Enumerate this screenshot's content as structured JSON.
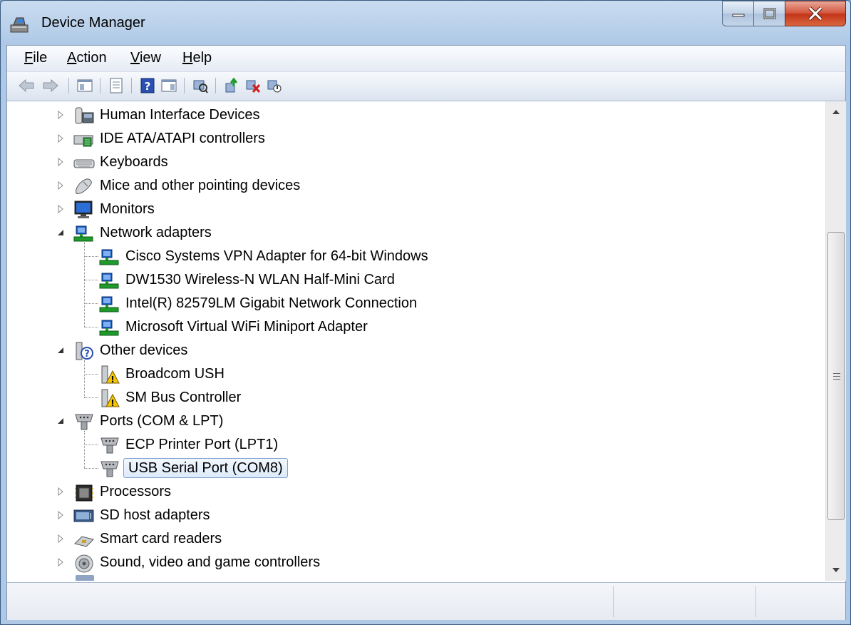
{
  "window": {
    "title": "Device Manager",
    "icon": "device-manager-icon"
  },
  "menu": {
    "items": [
      "File",
      "Action",
      "View",
      "Help"
    ],
    "mnemonics": [
      "F",
      "A",
      "V",
      "H"
    ]
  },
  "toolbar": {
    "buttons": [
      "back-arrow-icon",
      "forward-arrow-icon",
      "show-hide-console-tree-icon",
      "properties-icon",
      "help-icon",
      "show-action-pane-icon",
      "scan-hardware-changes-icon",
      "update-driver-icon",
      "uninstall-icon",
      "disable-device-icon"
    ]
  },
  "tree": {
    "rows": [
      {
        "label": "Human Interface Devices",
        "level": 0,
        "state": "collapsed",
        "icon": "hid-icon"
      },
      {
        "label": "IDE ATA/ATAPI controllers",
        "level": 0,
        "state": "collapsed",
        "icon": "ide-controller-icon"
      },
      {
        "label": "Keyboards",
        "level": 0,
        "state": "collapsed",
        "icon": "keyboard-icon"
      },
      {
        "label": "Mice and other pointing devices",
        "level": 0,
        "state": "collapsed",
        "icon": "mouse-icon"
      },
      {
        "label": "Monitors",
        "level": 0,
        "state": "collapsed",
        "icon": "monitor-icon"
      },
      {
        "label": "Network adapters",
        "level": 0,
        "state": "expanded",
        "icon": "network-adapter-icon"
      },
      {
        "label": "Cisco Systems VPN Adapter for 64-bit Windows",
        "level": 1,
        "state": "leaf",
        "icon": "network-adapter-icon"
      },
      {
        "label": "DW1530 Wireless-N WLAN Half-Mini Card",
        "level": 1,
        "state": "leaf",
        "icon": "network-adapter-icon"
      },
      {
        "label": "Intel(R) 82579LM Gigabit Network Connection",
        "level": 1,
        "state": "leaf",
        "icon": "network-adapter-icon"
      },
      {
        "label": "Microsoft Virtual WiFi Miniport Adapter",
        "level": 1,
        "state": "leaf",
        "icon": "network-adapter-icon"
      },
      {
        "label": "Other devices",
        "level": 0,
        "state": "expanded",
        "icon": "unknown-device-icon"
      },
      {
        "label": "Broadcom USH",
        "level": 1,
        "state": "leaf",
        "icon": "warning-device-icon"
      },
      {
        "label": "SM Bus Controller",
        "level": 1,
        "state": "leaf",
        "icon": "warning-device-icon"
      },
      {
        "label": "Ports (COM & LPT)",
        "level": 0,
        "state": "expanded",
        "icon": "port-icon"
      },
      {
        "label": "ECP Printer Port (LPT1)",
        "level": 1,
        "state": "leaf",
        "icon": "port-icon"
      },
      {
        "label": "USB Serial Port (COM8)",
        "level": 1,
        "state": "leaf",
        "icon": "port-icon",
        "selected": true
      },
      {
        "label": "Processors",
        "level": 0,
        "state": "collapsed",
        "icon": "processor-icon"
      },
      {
        "label": "SD host adapters",
        "level": 0,
        "state": "collapsed",
        "icon": "sd-adapter-icon"
      },
      {
        "label": "Smart card readers",
        "level": 0,
        "state": "collapsed",
        "icon": "smart-card-icon"
      },
      {
        "label": "Sound, video and game controllers",
        "level": 0,
        "state": "collapsed",
        "icon": "sound-icon"
      }
    ]
  },
  "scrollbar": {
    "thumb_start_fraction": 0.25,
    "thumb_end_fraction": 0.91
  },
  "colors": {
    "selection_border": "#7da2ce",
    "selection_fill": "#dcebfc",
    "close_button": "#c23317",
    "network_green": "#1f9b2c",
    "network_blue": "#1b5fc7",
    "warning_yellow": "#f5c400"
  }
}
